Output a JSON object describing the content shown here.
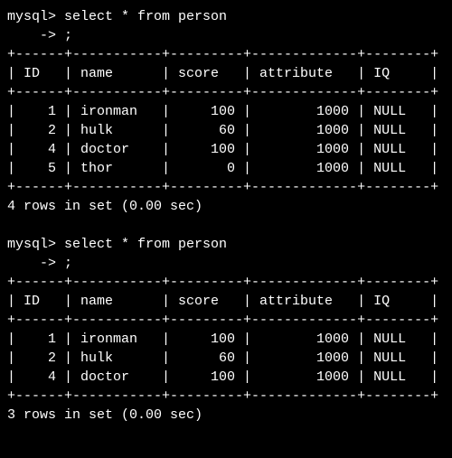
{
  "prompt_main": "mysql>",
  "prompt_cont": "    ->",
  "query_line1": "select * from person",
  "query_line2": ";",
  "columns": [
    "ID",
    "name",
    "score",
    "attribute",
    "IQ"
  ],
  "resultsets": [
    {
      "rows": [
        {
          "ID": "1",
          "name": "ironman",
          "score": "100",
          "attribute": "1000",
          "IQ": "NULL"
        },
        {
          "ID": "2",
          "name": "hulk",
          "score": "60",
          "attribute": "1000",
          "IQ": "NULL"
        },
        {
          "ID": "4",
          "name": "doctor",
          "score": "100",
          "attribute": "1000",
          "IQ": "NULL"
        },
        {
          "ID": "5",
          "name": "thor",
          "score": "0",
          "attribute": "1000",
          "IQ": "NULL"
        }
      ],
      "summary": "4 rows in set (0.00 sec)"
    },
    {
      "rows": [
        {
          "ID": "1",
          "name": "ironman",
          "score": "100",
          "attribute": "1000",
          "IQ": "NULL"
        },
        {
          "ID": "2",
          "name": "hulk",
          "score": "60",
          "attribute": "1000",
          "IQ": "NULL"
        },
        {
          "ID": "4",
          "name": "doctor",
          "score": "100",
          "attribute": "1000",
          "IQ": "NULL"
        }
      ],
      "summary": "3 rows in set (0.00 sec)"
    }
  ],
  "col_widths": {
    "ID": 4,
    "name": 9,
    "score": 7,
    "attribute": 11,
    "IQ": 6
  }
}
